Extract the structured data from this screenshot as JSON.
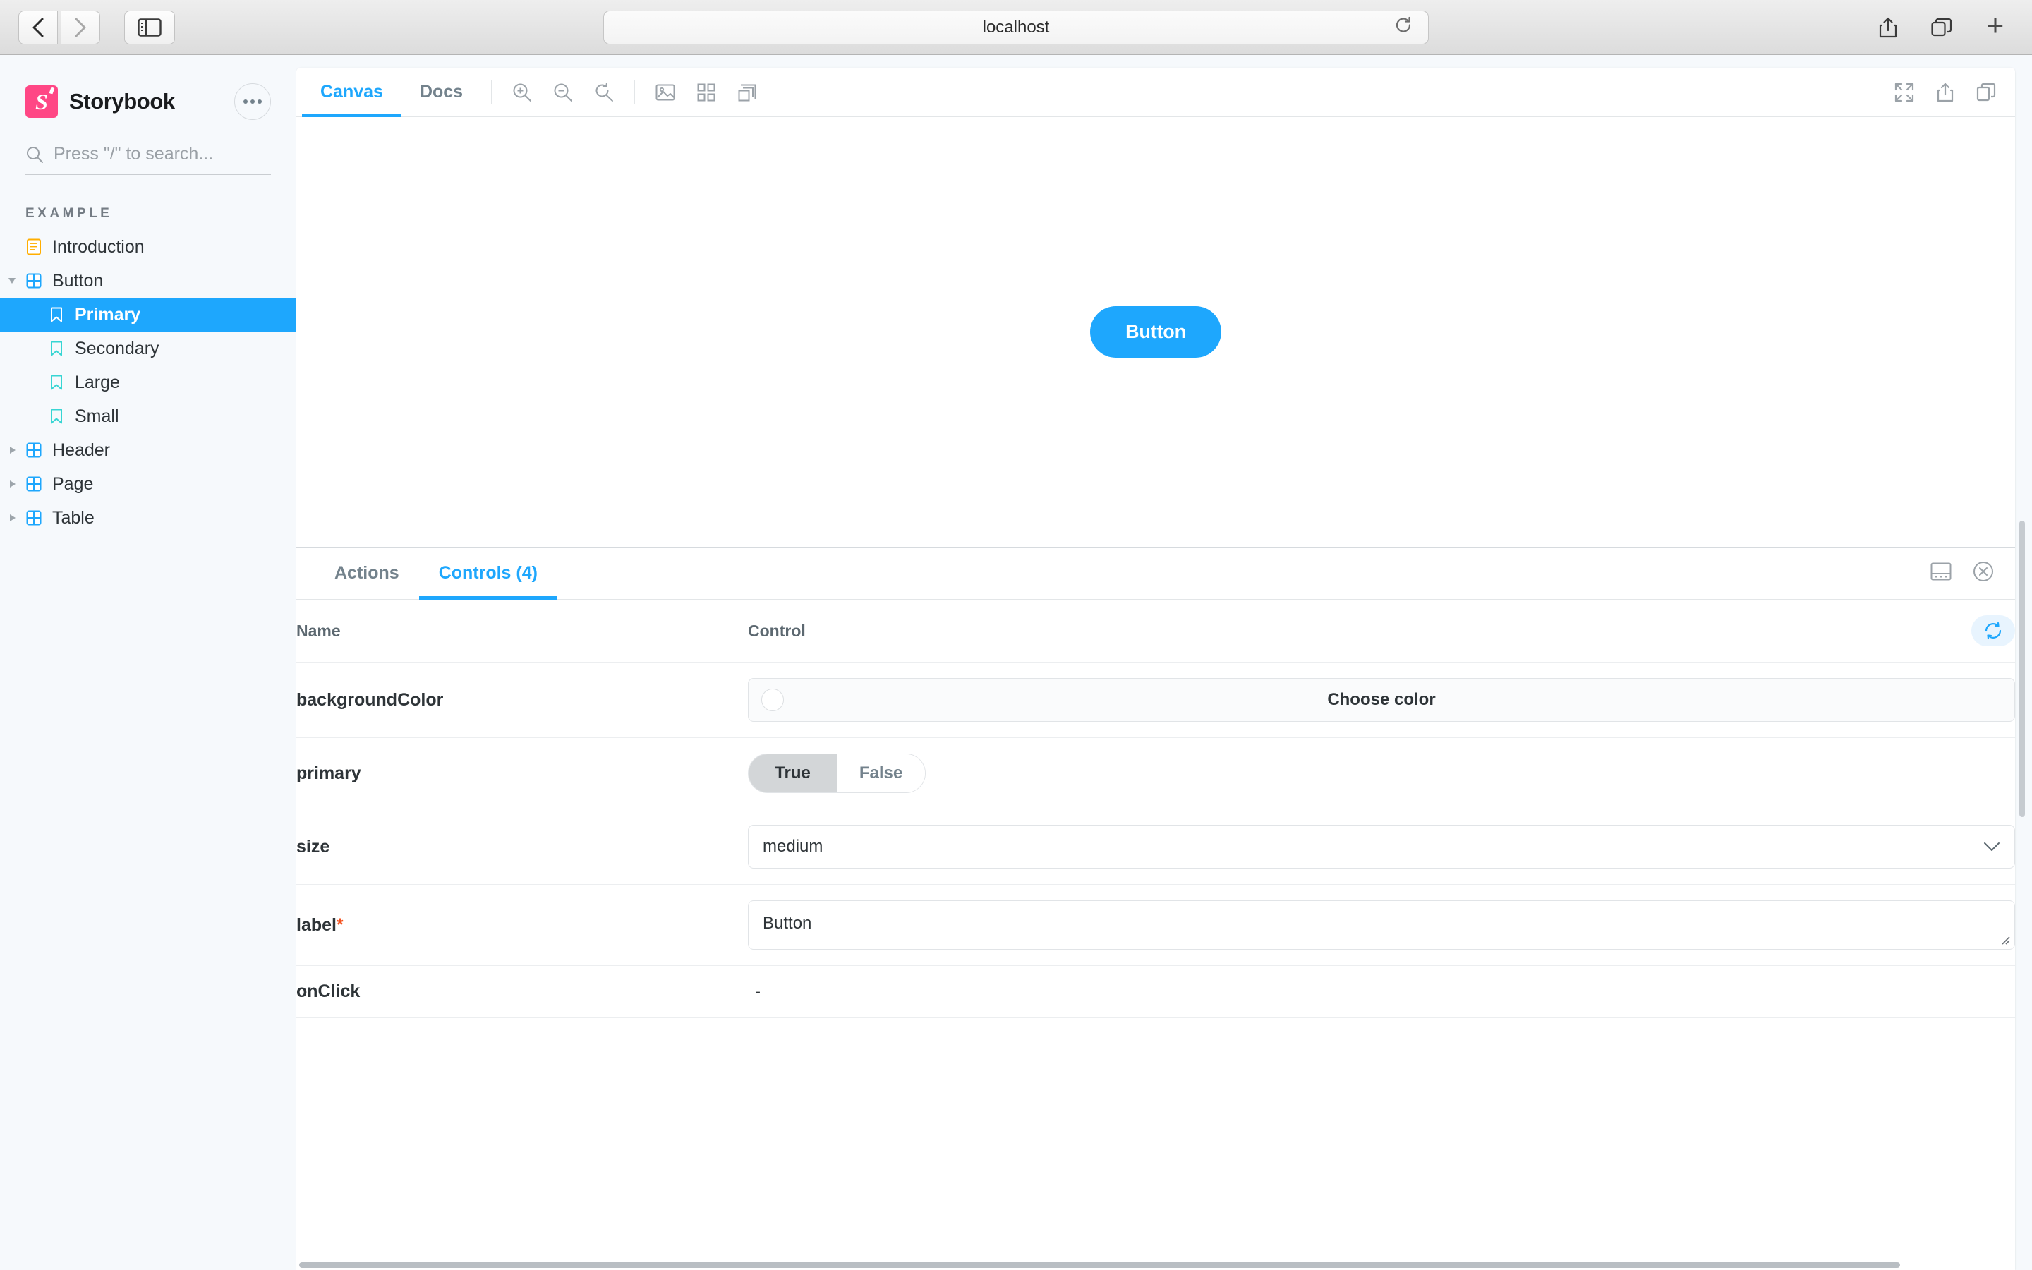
{
  "browser": {
    "url": "localhost",
    "back_label": "Back",
    "forward_label": "Forward",
    "sidebar_toggle_label": "Show sidebar",
    "reload_label": "Reload",
    "share_label": "Share",
    "tabs_label": "Tab overview",
    "new_tab_label": "New tab"
  },
  "sidebar": {
    "brand": "Storybook",
    "menu_label": "Shortcuts menu",
    "search_placeholder": "Press \"/\" to search...",
    "section": "EXAMPLE",
    "items": [
      {
        "label": "Introduction",
        "icon": "document-icon",
        "level": 0,
        "expandable": false,
        "selected": false
      },
      {
        "label": "Button",
        "icon": "component-icon",
        "level": 0,
        "expandable": true,
        "expanded": true,
        "selected": false
      },
      {
        "label": "Primary",
        "icon": "story-icon",
        "level": 1,
        "expandable": false,
        "selected": true
      },
      {
        "label": "Secondary",
        "icon": "story-icon",
        "level": 1,
        "expandable": false,
        "selected": false
      },
      {
        "label": "Large",
        "icon": "story-icon",
        "level": 1,
        "expandable": false,
        "selected": false
      },
      {
        "label": "Small",
        "icon": "story-icon",
        "level": 1,
        "expandable": false,
        "selected": false
      },
      {
        "label": "Header",
        "icon": "component-icon",
        "level": 0,
        "expandable": true,
        "expanded": false,
        "selected": false
      },
      {
        "label": "Page",
        "icon": "component-icon",
        "level": 0,
        "expandable": true,
        "expanded": false,
        "selected": false
      },
      {
        "label": "Table",
        "icon": "component-icon",
        "level": 0,
        "expandable": true,
        "expanded": false,
        "selected": false
      }
    ]
  },
  "toolbar": {
    "tabs": [
      {
        "label": "Canvas",
        "active": true
      },
      {
        "label": "Docs",
        "active": false
      }
    ],
    "icons": [
      "zoom-in-icon",
      "zoom-out-icon",
      "zoom-reset-icon",
      "background-image-icon",
      "grid-icon",
      "measure-icon"
    ],
    "right_icons": [
      "fullscreen-icon",
      "share-icon",
      "copy-icon"
    ]
  },
  "canvas": {
    "button_label": "Button",
    "button_color": "#1ea7fd"
  },
  "panel": {
    "tabs": [
      {
        "label": "Actions",
        "active": false
      },
      {
        "label": "Controls (4)",
        "active": true
      }
    ],
    "right_icons": [
      "panel-position-icon",
      "close-panel-icon"
    ],
    "reset_label": "Reset controls",
    "columns": {
      "name": "Name",
      "control": "Control"
    },
    "rows": [
      {
        "name": "backgroundColor",
        "required": false,
        "control_type": "color",
        "placeholder": "Choose color",
        "value": ""
      },
      {
        "name": "primary",
        "required": false,
        "control_type": "boolean",
        "options": [
          "True",
          "False"
        ],
        "value": "True"
      },
      {
        "name": "size",
        "required": false,
        "control_type": "select",
        "value": "medium"
      },
      {
        "name": "label",
        "required": true,
        "control_type": "text",
        "value": "Button"
      },
      {
        "name": "onClick",
        "required": false,
        "control_type": "empty",
        "value": "-"
      }
    ]
  },
  "colors": {
    "accent": "#1ea7fd",
    "brand_pink": "#ff4785",
    "story_icon": "#37d5d3",
    "component_icon": "#1ea7fd",
    "document_icon": "#ffae00",
    "required_star": "#f4511e"
  }
}
